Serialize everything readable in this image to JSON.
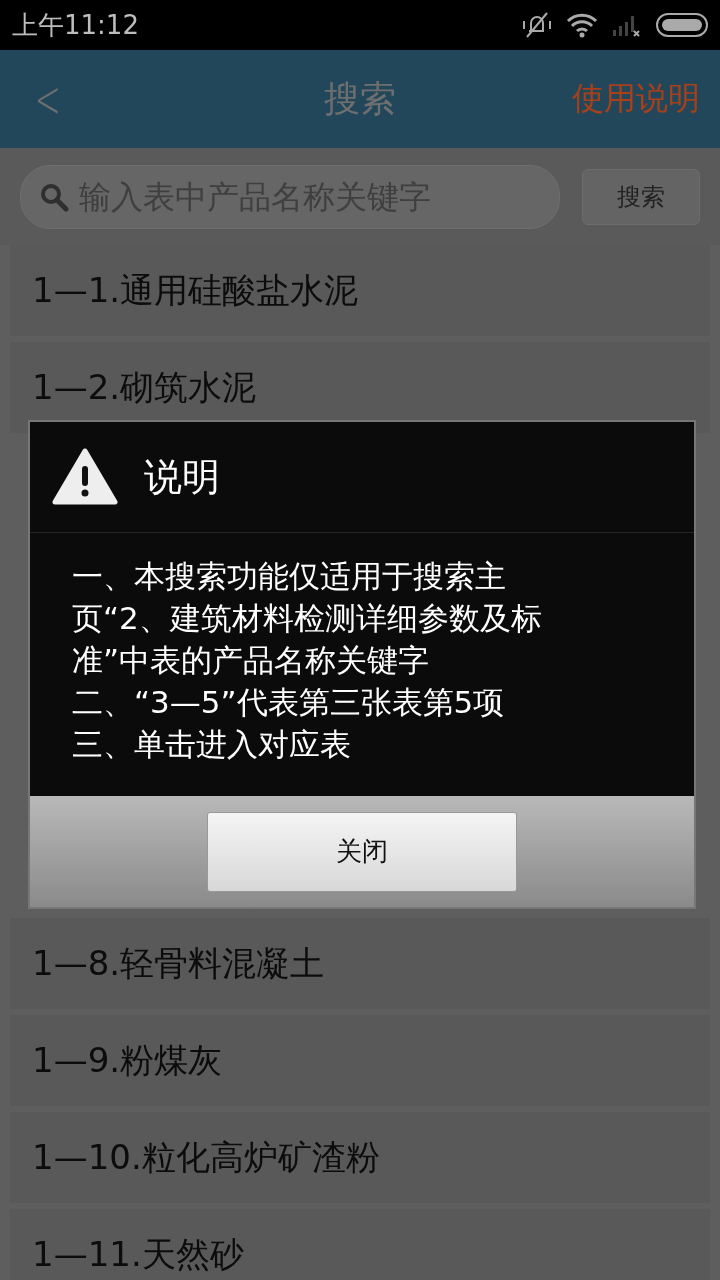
{
  "status_bar": {
    "time": "上午11:12"
  },
  "header": {
    "back": "<",
    "title": "搜索",
    "help": "使用说明"
  },
  "search": {
    "placeholder": "输入表中产品名称关键字",
    "button": "搜索"
  },
  "list_top": [
    {
      "label": "1—1.通用硅酸盐水泥"
    },
    {
      "label": "1—2.砌筑水泥"
    }
  ],
  "list_bottom": [
    {
      "label": "1—8.轻骨料混凝土"
    },
    {
      "label": "1—9.粉煤灰"
    },
    {
      "label": "1—10.粒化高炉矿渣粉"
    },
    {
      "label": "1—11.天然砂"
    }
  ],
  "dialog": {
    "title": "说明",
    "lines": [
      "一、本搜索功能仅适用于搜索主页“2、建筑材料检测详细参数及标准”中表的产品名称关键字",
      "二、“3—5”代表第三张表第5项",
      "三、单击进入对应表"
    ],
    "button": "关闭"
  }
}
